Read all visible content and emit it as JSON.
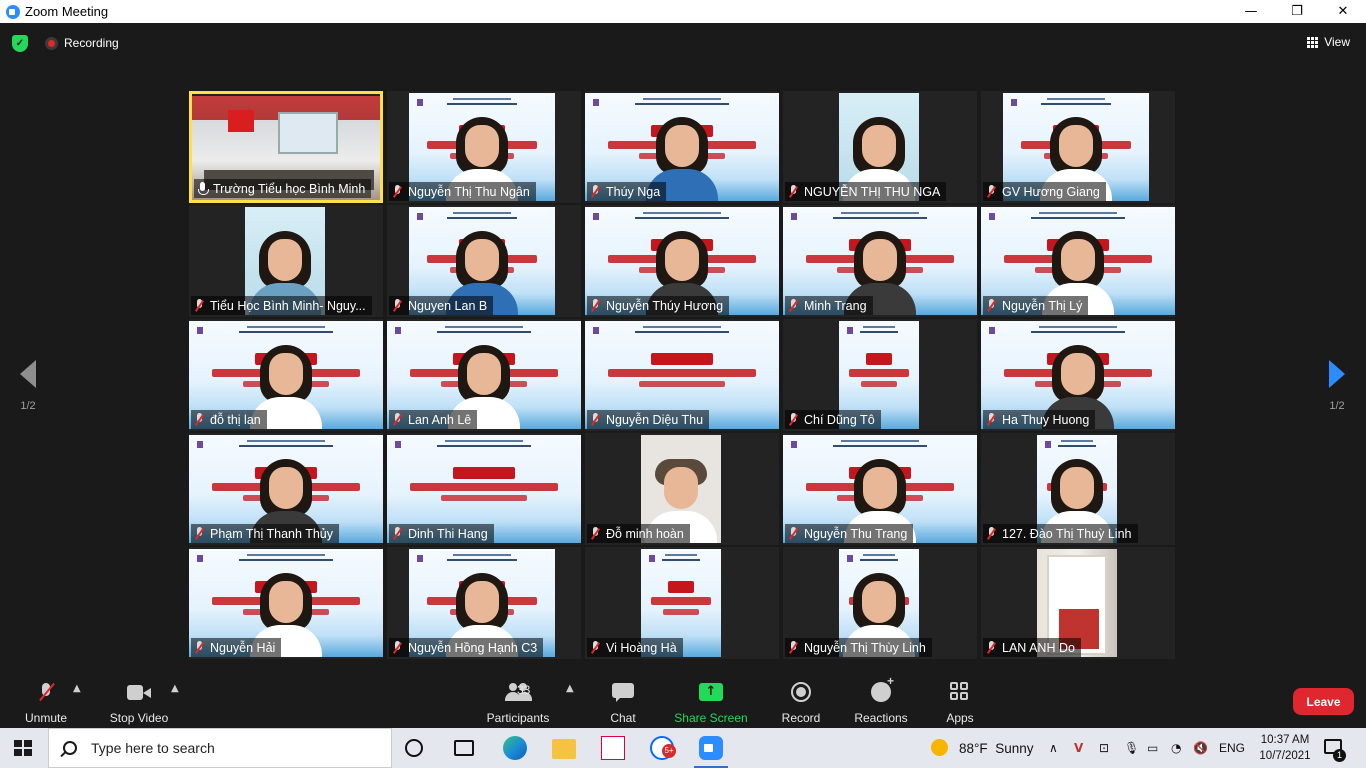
{
  "window": {
    "title": "Zoom Meeting"
  },
  "topbar": {
    "recording_label": "Recording",
    "view_label": "View"
  },
  "pager": {
    "left_page": "1/2",
    "right_page": "1/2"
  },
  "participants": [
    {
      "name": "Trường Tiểu học Bình Minh",
      "muted": false,
      "active_speaker": true,
      "feed": "room"
    },
    {
      "name": "Nguyễn Thị Thu Ngân",
      "muted": true,
      "feed": "slide"
    },
    {
      "name": "Thúy Nga",
      "muted": true,
      "feed": "slide"
    },
    {
      "name": "NGUYỄN THỊ THU NGA",
      "muted": true,
      "feed": "photo"
    },
    {
      "name": "GV Hương Giang",
      "muted": true,
      "feed": "slide"
    },
    {
      "name": "Tiểu Học Bình Minh- Nguy...",
      "muted": true,
      "feed": "photo"
    },
    {
      "name": "Nguyen Lan B",
      "muted": true,
      "feed": "slide"
    },
    {
      "name": "Nguyễn Thúy Hương",
      "muted": true,
      "feed": "slide"
    },
    {
      "name": "Minh Trang",
      "muted": true,
      "feed": "slide"
    },
    {
      "name": "Nguyễn Thị Lý",
      "muted": true,
      "feed": "slide"
    },
    {
      "name": "đỗ thị lan",
      "muted": true,
      "feed": "slide"
    },
    {
      "name": "Lan Anh Lê",
      "muted": true,
      "feed": "slide"
    },
    {
      "name": "Nguyễn Diệu Thu",
      "muted": true,
      "feed": "slide"
    },
    {
      "name": "Chí Dũng Tô",
      "muted": true,
      "feed": "slide"
    },
    {
      "name": "Ha Thuy Huong",
      "muted": true,
      "feed": "slide"
    },
    {
      "name": "Phạm Thị Thanh Thủy",
      "muted": true,
      "feed": "slide"
    },
    {
      "name": "Dinh Thi Hang",
      "muted": true,
      "feed": "slide"
    },
    {
      "name": "Đỗ minh hoàn",
      "muted": true,
      "feed": "camera"
    },
    {
      "name": "Nguyễn Thu Trang",
      "muted": true,
      "feed": "slide"
    },
    {
      "name": "127. Đào Thị Thuỳ Linh",
      "muted": true,
      "feed": "slide"
    },
    {
      "name": "Nguyễn Hải",
      "muted": true,
      "feed": "slide"
    },
    {
      "name": "Nguyễn Hồng Hạnh C3",
      "muted": true,
      "feed": "slide"
    },
    {
      "name": "Vi Hoàng Hà",
      "muted": true,
      "feed": "slide"
    },
    {
      "name": "Nguyễn Thị Thùy Linh",
      "muted": true,
      "feed": "slide"
    },
    {
      "name": "LAN ANH Do",
      "muted": true,
      "feed": "room2"
    }
  ],
  "toolbar": {
    "unmute_label": "Unmute",
    "stop_video_label": "Stop Video",
    "participants_label": "Participants",
    "participants_count": "33",
    "chat_label": "Chat",
    "share_screen_label": "Share Screen",
    "record_label": "Record",
    "reactions_label": "Reactions",
    "apps_label": "Apps",
    "leave_label": "Leave",
    "share_color": "#23d959",
    "leave_color": "#e0262e"
  },
  "taskbar": {
    "search_placeholder": "Type here to search",
    "zalo_badge": "5+",
    "temperature": "88°F",
    "weather": "Sunny",
    "language": "ENG",
    "time": "10:37 AM",
    "date": "10/7/2021",
    "notification_count": "1"
  }
}
